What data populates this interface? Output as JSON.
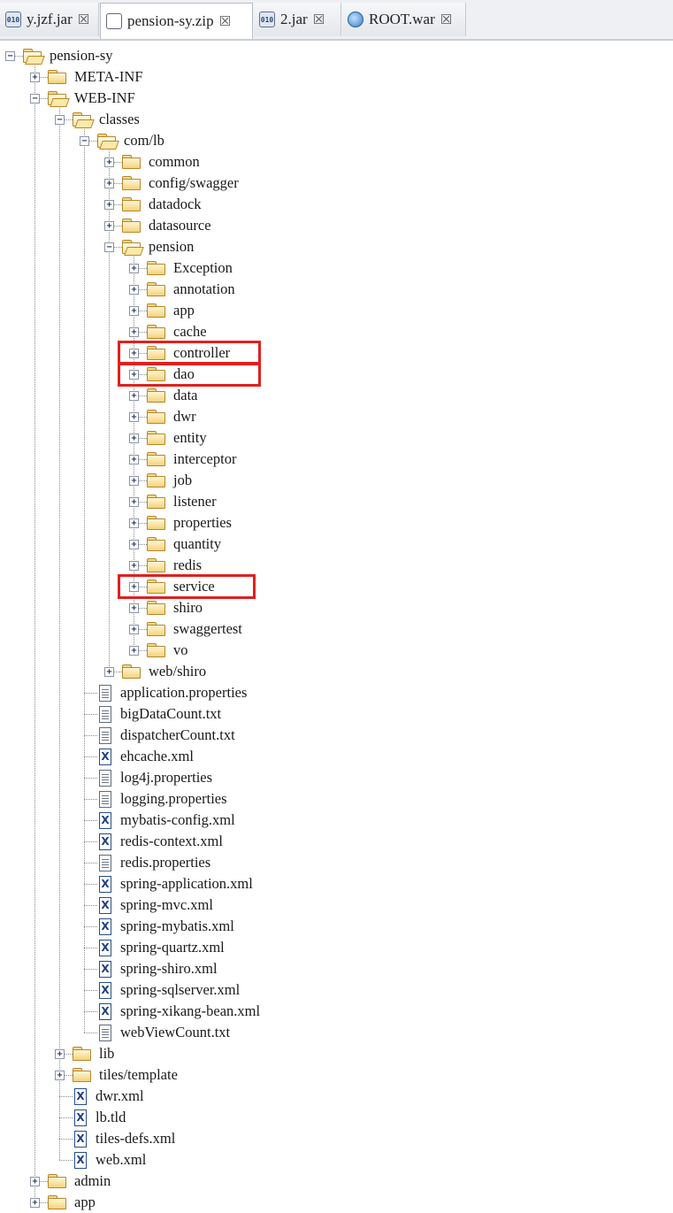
{
  "tabs": [
    {
      "label": "y.jzf.jar",
      "icon": "jar-icon",
      "active": false
    },
    {
      "label": "pension-sy.zip",
      "icon": "zip-icon",
      "active": true
    },
    {
      "label": "2.jar",
      "icon": "jar-icon",
      "active": false
    },
    {
      "label": "ROOT.war",
      "icon": "war-icon",
      "active": false
    }
  ],
  "tab_close_glyph": "☒",
  "highlight_color": "#e0201f",
  "tree": [
    {
      "label": "pension-sy",
      "type": "folder",
      "expanded": true,
      "depth": 0
    },
    {
      "label": "META-INF",
      "type": "folder",
      "expanded": false,
      "depth": 1
    },
    {
      "label": "WEB-INF",
      "type": "folder",
      "expanded": true,
      "depth": 1
    },
    {
      "label": "classes",
      "type": "folder",
      "expanded": true,
      "depth": 2
    },
    {
      "label": "com/lb",
      "type": "folder",
      "expanded": true,
      "depth": 3
    },
    {
      "label": "common",
      "type": "folder",
      "expanded": false,
      "depth": 4
    },
    {
      "label": "config/swagger",
      "type": "folder",
      "expanded": false,
      "depth": 4
    },
    {
      "label": "datadock",
      "type": "folder",
      "expanded": false,
      "depth": 4
    },
    {
      "label": "datasource",
      "type": "folder",
      "expanded": false,
      "depth": 4
    },
    {
      "label": "pension",
      "type": "folder",
      "expanded": true,
      "depth": 4
    },
    {
      "label": "Exception",
      "type": "folder",
      "expanded": false,
      "depth": 5
    },
    {
      "label": "annotation",
      "type": "folder",
      "expanded": false,
      "depth": 5
    },
    {
      "label": "app",
      "type": "folder",
      "expanded": false,
      "depth": 5
    },
    {
      "label": "cache",
      "type": "folder",
      "expanded": false,
      "depth": 5
    },
    {
      "label": "controller",
      "type": "folder",
      "expanded": false,
      "depth": 5,
      "highlighted": true
    },
    {
      "label": "dao",
      "type": "folder",
      "expanded": false,
      "depth": 5,
      "highlighted": true
    },
    {
      "label": "data",
      "type": "folder",
      "expanded": false,
      "depth": 5
    },
    {
      "label": "dwr",
      "type": "folder",
      "expanded": false,
      "depth": 5
    },
    {
      "label": "entity",
      "type": "folder",
      "expanded": false,
      "depth": 5
    },
    {
      "label": "interceptor",
      "type": "folder",
      "expanded": false,
      "depth": 5
    },
    {
      "label": "job",
      "type": "folder",
      "expanded": false,
      "depth": 5
    },
    {
      "label": "listener",
      "type": "folder",
      "expanded": false,
      "depth": 5
    },
    {
      "label": "properties",
      "type": "folder",
      "expanded": false,
      "depth": 5
    },
    {
      "label": "quantity",
      "type": "folder",
      "expanded": false,
      "depth": 5
    },
    {
      "label": "redis",
      "type": "folder",
      "expanded": false,
      "depth": 5
    },
    {
      "label": "service",
      "type": "folder",
      "expanded": false,
      "depth": 5,
      "highlighted": true
    },
    {
      "label": "shiro",
      "type": "folder",
      "expanded": false,
      "depth": 5
    },
    {
      "label": "swaggertest",
      "type": "folder",
      "expanded": false,
      "depth": 5
    },
    {
      "label": "vo",
      "type": "folder",
      "expanded": false,
      "depth": 5
    },
    {
      "label": "web/shiro",
      "type": "folder",
      "expanded": false,
      "depth": 4
    },
    {
      "label": "application.properties",
      "type": "doc",
      "depth": 3
    },
    {
      "label": "bigDataCount.txt",
      "type": "doc",
      "depth": 3
    },
    {
      "label": "dispatcherCount.txt",
      "type": "doc",
      "depth": 3
    },
    {
      "label": "ehcache.xml",
      "type": "xml",
      "depth": 3
    },
    {
      "label": "log4j.properties",
      "type": "doc",
      "depth": 3
    },
    {
      "label": "logging.properties",
      "type": "doc",
      "depth": 3
    },
    {
      "label": "mybatis-config.xml",
      "type": "xml",
      "depth": 3
    },
    {
      "label": "redis-context.xml",
      "type": "xml",
      "depth": 3
    },
    {
      "label": "redis.properties",
      "type": "doc",
      "depth": 3
    },
    {
      "label": "spring-application.xml",
      "type": "xml",
      "depth": 3
    },
    {
      "label": "spring-mvc.xml",
      "type": "xml",
      "depth": 3
    },
    {
      "label": "spring-mybatis.xml",
      "type": "xml",
      "depth": 3
    },
    {
      "label": "spring-quartz.xml",
      "type": "xml",
      "depth": 3
    },
    {
      "label": "spring-shiro.xml",
      "type": "xml",
      "depth": 3
    },
    {
      "label": "spring-sqlserver.xml",
      "type": "xml",
      "depth": 3
    },
    {
      "label": "spring-xikang-bean.xml",
      "type": "xml",
      "depth": 3
    },
    {
      "label": "webViewCount.txt",
      "type": "doc",
      "depth": 3
    },
    {
      "label": "lib",
      "type": "folder",
      "expanded": false,
      "depth": 2
    },
    {
      "label": "tiles/template",
      "type": "folder",
      "expanded": false,
      "depth": 2
    },
    {
      "label": "dwr.xml",
      "type": "xml",
      "depth": 2
    },
    {
      "label": "lb.tld",
      "type": "xml",
      "depth": 2
    },
    {
      "label": "tiles-defs.xml",
      "type": "xml",
      "depth": 2
    },
    {
      "label": "web.xml",
      "type": "xml",
      "depth": 2
    },
    {
      "label": "admin",
      "type": "folder",
      "expanded": false,
      "depth": 1
    },
    {
      "label": "app",
      "type": "folder",
      "expanded": false,
      "depth": 1
    }
  ]
}
